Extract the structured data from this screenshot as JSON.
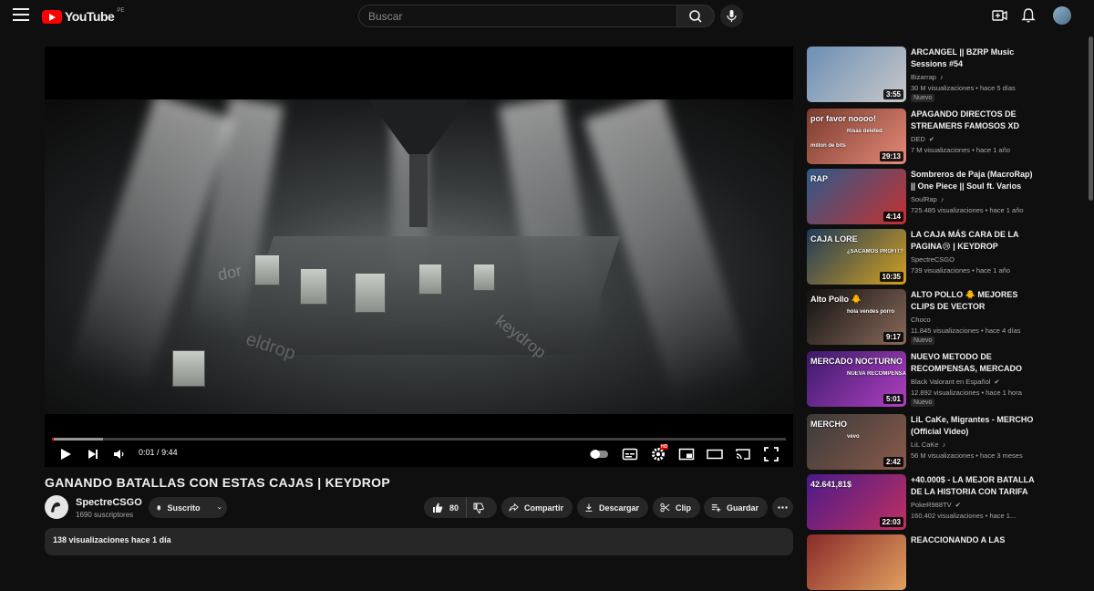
{
  "header": {
    "logo_text": "YouTube",
    "country": "PE",
    "search_placeholder": "Buscar"
  },
  "player": {
    "current_time": "0:01",
    "separator": "/",
    "duration": "9:44",
    "progress_fraction": 0.002,
    "buffered_fraction": 0.07,
    "hd_badge": "HD",
    "watermark_left": "dor",
    "watermark_bottom": "eldrop",
    "watermark_right": "keydrop"
  },
  "video": {
    "title": "GANANDO BATALLAS CON ESTAS CAJAS | KEYDROP",
    "channel_name": "SpectreCSGO",
    "subscribers": "1690 suscriptores",
    "subscribe_label": "Suscrito",
    "likes": "80",
    "share_label": "Compartir",
    "download_label": "Descargar",
    "clip_label": "Clip",
    "save_label": "Guardar",
    "description_meta": "138 visualizaciones  hace 1 día"
  },
  "recommendations": [
    {
      "title": "ARCANGEL || BZRP Music Sessions #54",
      "channel": "Bizarrap",
      "channel_mark": "♪",
      "views": "30 M visualizaciones",
      "age": "hace 5 días",
      "duration": "3:55",
      "is_new": true,
      "badge": "Nuevo",
      "thumb_colors": [
        "#6b8fb5",
        "#c8c8c8"
      ]
    },
    {
      "title": "APAGANDO DIRECTOS DE STREAMERS FAMOSOS XD",
      "channel": "DED",
      "channel_mark": "✔",
      "views": "7 M visualizaciones",
      "age": "hace 1 año",
      "duration": "29:13",
      "is_new": false,
      "thumb_colors": [
        "#7a3b2e",
        "#e58a78"
      ],
      "thumb_texts": [
        "por favor noooo!",
        "Risas deleted",
        "millon de bits"
      ]
    },
    {
      "title": "Sombreros de Paja (MacroRap) || One Piece || Soul ft. Varios Artistas",
      "channel": "SoulRap",
      "channel_mark": "♪",
      "views": "725.485 visualizaciones",
      "age": "hace 1 año",
      "duration": "4:14",
      "is_new": false,
      "thumb_colors": [
        "#2d5a8a",
        "#c43030"
      ],
      "thumb_texts": [
        "RAP"
      ]
    },
    {
      "title": "LA CAJA MÁS CARA DE LA PAGINA😢 | KEYDROP",
      "channel": "SpectreCSGO",
      "views": "739 visualizaciones",
      "age": "hace 1 año",
      "duration": "10:35",
      "is_new": false,
      "thumb_colors": [
        "#1e3a5a",
        "#d4a020"
      ],
      "thumb_texts": [
        "CAJA LORE",
        "¿SACAMOS PROFIT?"
      ]
    },
    {
      "title": "ALTO POLLO 🐥 MEJORES CLIPS DE VECTOR",
      "channel": "Choco",
      "views": "11.845 visualizaciones",
      "age": "hace 4 días",
      "duration": "9:17",
      "is_new": true,
      "badge": "Nuevo",
      "thumb_colors": [
        "#111111",
        "#8a6a5a"
      ],
      "thumb_texts": [
        "Alto Pollo 🐥",
        "hola vendes porro"
      ]
    },
    {
      "title": "NUEVO METODO DE RECOMPENSAS, MERCADO NOCTURNO",
      "channel": "Black Valorant en Español",
      "channel_mark": "✔",
      "views": "12.892 visualizaciones",
      "age": "hace 1 hora",
      "duration": "5:01",
      "is_new": true,
      "badge": "Nuevo",
      "thumb_colors": [
        "#3a1a6a",
        "#b040c0"
      ],
      "thumb_texts": [
        "MERCADO NOCTURNO",
        "NUEVA RECOMPENSA"
      ]
    },
    {
      "title": "LiL CaKe, Migrantes - MERCHO (Official Video)",
      "channel": "LiL CaKe",
      "channel_mark": "♪",
      "views": "56 M visualizaciones",
      "age": "hace 3 meses",
      "duration": "2:42",
      "is_new": false,
      "thumb_colors": [
        "#3a3a3a",
        "#8a5a4a"
      ],
      "thumb_texts": [
        "MERCHO",
        "vevo"
      ]
    },
    {
      "title": "+40.000$ - LA MEJOR BATALLA DE LA HISTORIA CON TARIFA",
      "channel": "PokeR988TV",
      "channel_mark": "✔",
      "views": "160.402 visualizaciones",
      "age": "hace 1...",
      "duration": "22:03",
      "is_new": false,
      "thumb_colors": [
        "#4a1a8a",
        "#c03060"
      ],
      "thumb_texts": [
        "42.641,81$"
      ]
    },
    {
      "title": "REACCIONANDO A LAS",
      "channel": "",
      "views": "",
      "age": "",
      "duration": "",
      "is_new": false,
      "thumb_colors": [
        "#8a2a2a",
        "#e0a060"
      ]
    }
  ]
}
